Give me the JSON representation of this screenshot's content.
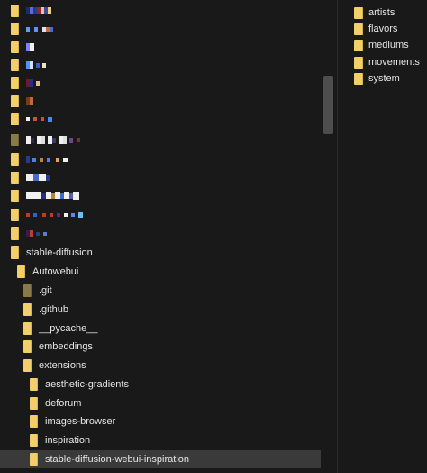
{
  "tree": {
    "named_items": [
      {
        "label": "stable-diffusion"
      },
      {
        "label": "Autowebui"
      },
      {
        "label": ".git"
      },
      {
        "label": ".github"
      },
      {
        "label": "__pycache__"
      },
      {
        "label": "embeddings"
      },
      {
        "label": "extensions"
      },
      {
        "label": "aesthetic-gradients"
      },
      {
        "label": "deforum"
      },
      {
        "label": "images-browser"
      },
      {
        "label": "inspiration"
      },
      {
        "label": "stable-diffusion-webui-inspiration"
      }
    ]
  },
  "contents": {
    "items": [
      {
        "label": "artists"
      },
      {
        "label": "flavors"
      },
      {
        "label": "mediums"
      },
      {
        "label": "movements"
      },
      {
        "label": "system"
      }
    ]
  }
}
